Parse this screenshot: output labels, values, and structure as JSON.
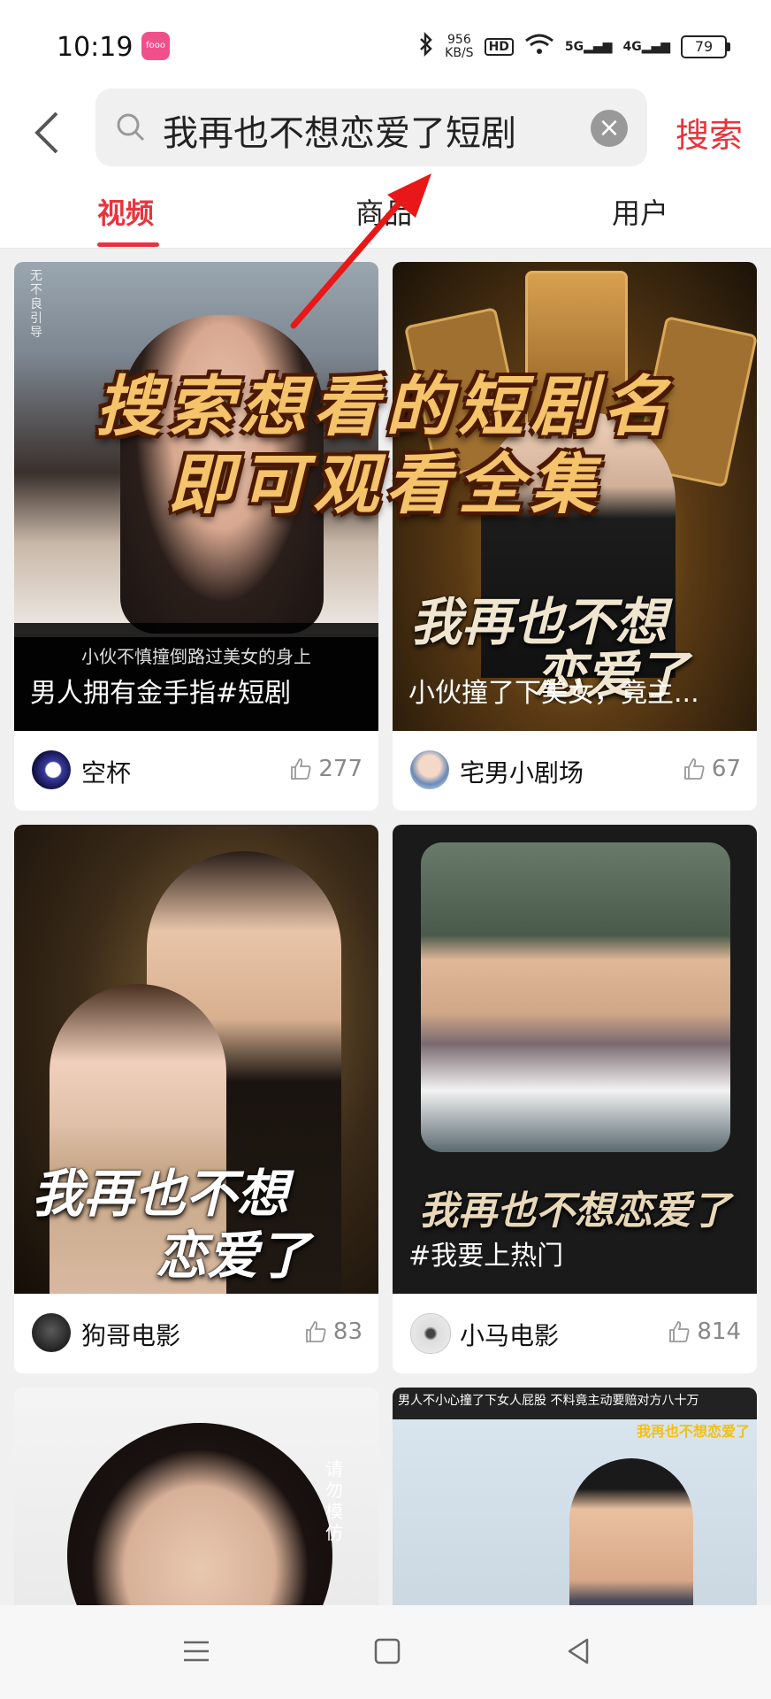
{
  "status": {
    "time": "10:19",
    "app_badge": "fooo",
    "net_speed_value": "956",
    "net_speed_unit": "KB/S",
    "hd": "HD",
    "sig1": "5G",
    "sig2": "4G",
    "battery": "79"
  },
  "search": {
    "query": "我再也不想恋爱了短剧",
    "clear": "×",
    "button": "搜索"
  },
  "tabs": [
    "视频",
    "商品",
    "用户"
  ],
  "overlay": {
    "line1": "搜索想看的短剧名",
    "line2": "即可观看全集"
  },
  "cards": [
    {
      "vertical_watermark": "无不良引导",
      "subcaption": "小伙不慎撞倒路过美女的身上",
      "caption": "男人拥有金手指#短剧",
      "author": "空杯",
      "likes": "277"
    },
    {
      "poster_line1": "我再也不想",
      "poster_line2": "恋爱了",
      "caption": "小伙撞了下美女，竟主...",
      "author": "宅男小剧场",
      "likes": "67"
    },
    {
      "poster_line1": "我再也不想",
      "poster_line2": "恋爱了",
      "author": "狗哥电影",
      "likes": "83"
    },
    {
      "poster_line1": "我再也不想恋爱了",
      "caption": "#我要上热门",
      "author": "小马电影",
      "likes": "814"
    },
    {
      "side_text": "请勿模仿"
    },
    {
      "top_banner": "男人不小心撞了下女人屁股 不料竟主动要赔对方八十万",
      "corner_tag": "我再也不想恋爱了"
    }
  ]
}
